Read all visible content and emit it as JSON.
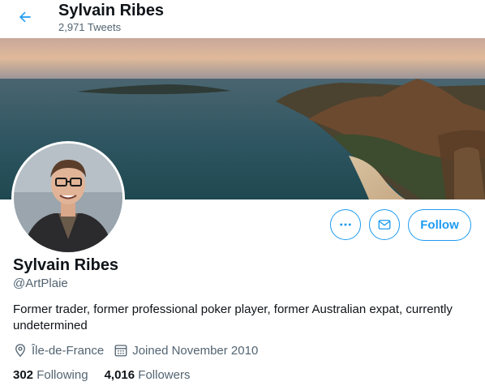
{
  "header": {
    "name": "Sylvain Ribes",
    "tweet_count": "2,971 Tweets"
  },
  "profile": {
    "name": "Sylvain Ribes",
    "handle": "@ArtPlaie",
    "bio": "Former trader, former professional poker player, former Australian expat, currently undetermined",
    "location": "Île-de-France",
    "joined": "Joined November 2010",
    "following_count": "302",
    "following_label": "Following",
    "followers_count": "4,016",
    "followers_label": "Followers"
  },
  "actions": {
    "follow_label": "Follow"
  },
  "icons": {
    "back": "arrow-left-icon",
    "more": "more-dots-icon",
    "message": "envelope-icon",
    "location": "location-pin-icon",
    "calendar": "calendar-icon"
  },
  "colors": {
    "accent": "#1d9bf0",
    "secondary_text": "#536471",
    "primary_text": "#0f1419"
  }
}
